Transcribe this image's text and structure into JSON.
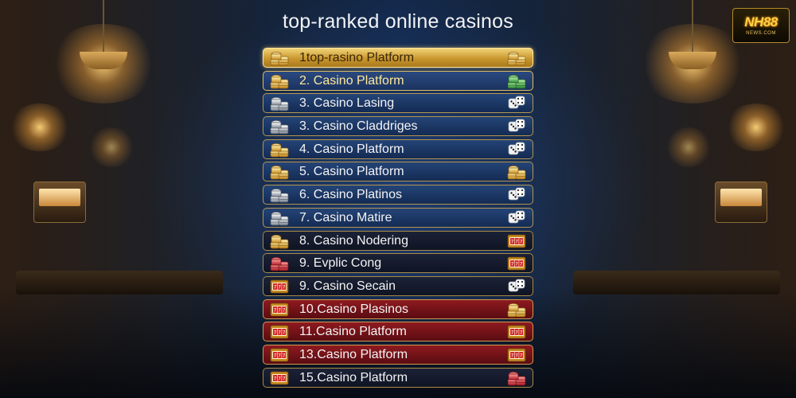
{
  "title": "top-ranked online casinos",
  "logo": {
    "brand": "NH88",
    "sub": "NEWS.COM"
  },
  "colors": {
    "gold": "#e4b650",
    "navy": "#1a3260",
    "crimson": "#7a1418"
  },
  "rows": [
    {
      "label": "1top-rasino Platform",
      "style": "gold",
      "icon_left": "gold-coins-icon",
      "icon_right": "gold-coins-icon"
    },
    {
      "label": "2. Casino Platform",
      "style": "goldblue",
      "icon_left": "gold-coins-icon",
      "icon_right": "green-chips-icon"
    },
    {
      "label": "3. Casino Lasing",
      "style": "blue",
      "icon_left": "silver-coins-icon",
      "icon_right": "dice-icon"
    },
    {
      "label": "3. Casino Claddriges",
      "style": "blue",
      "icon_left": "silver-coins-icon",
      "icon_right": "dice-icon"
    },
    {
      "label": "4. Casino Platform",
      "style": "blue",
      "icon_left": "gold-coins-icon",
      "icon_right": "dice-icon"
    },
    {
      "label": "5. Casino Platform",
      "style": "blue",
      "icon_left": "gold-coins-icon",
      "icon_right": "gold-coins-icon"
    },
    {
      "label": "6. Casino Platinos",
      "style": "blue",
      "icon_left": "silver-coins-icon",
      "icon_right": "dice-icon"
    },
    {
      "label": "7. Casino Matire",
      "style": "blue",
      "icon_left": "silver-coins-icon",
      "icon_right": "dice-icon"
    },
    {
      "label": "8. Casino Nodering",
      "style": "dark",
      "icon_left": "gold-coins-icon",
      "icon_right": "slot-machine-icon"
    },
    {
      "label": "9. Evplic Cong",
      "style": "dark",
      "icon_left": "red-chips-icon",
      "icon_right": "slot-machine-icon"
    },
    {
      "label": "9. Casino Secain",
      "style": "dark",
      "icon_left": "slot-machine-icon",
      "icon_right": "dice-icon"
    },
    {
      "label": "10.Casino Plasinos",
      "style": "red",
      "icon_left": "slot-machine-icon",
      "icon_right": "gold-coins-icon"
    },
    {
      "label": "11.Casino Platform",
      "style": "red",
      "icon_left": "slot-machine-icon",
      "icon_right": "slot-machine-icon"
    },
    {
      "label": "13.Casino Platform",
      "style": "red",
      "icon_left": "slot-machine-icon",
      "icon_right": "slot-machine-icon"
    },
    {
      "label": "15.Casino Platform",
      "style": "dark",
      "icon_left": "slot-machine-icon",
      "icon_right": "red-chips-icon"
    }
  ]
}
